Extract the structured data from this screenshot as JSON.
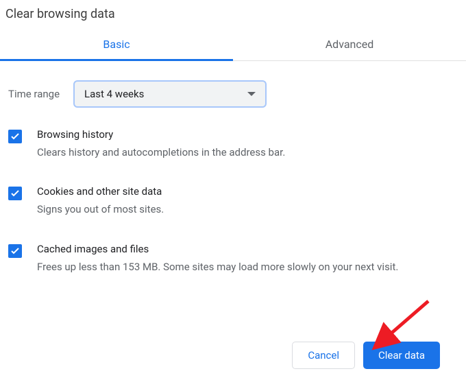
{
  "dialog": {
    "title": "Clear browsing data"
  },
  "tabs": {
    "basic": "Basic",
    "advanced": "Advanced"
  },
  "timeRange": {
    "label": "Time range",
    "selected": "Last 4 weeks"
  },
  "options": [
    {
      "title": "Browsing history",
      "desc": "Clears history and autocompletions in the address bar."
    },
    {
      "title": "Cookies and other site data",
      "desc": "Signs you out of most sites."
    },
    {
      "title": "Cached images and files",
      "desc": "Frees up less than 153 MB. Some sites may load more slowly on your next visit."
    }
  ],
  "buttons": {
    "cancel": "Cancel",
    "clear": "Clear data"
  }
}
